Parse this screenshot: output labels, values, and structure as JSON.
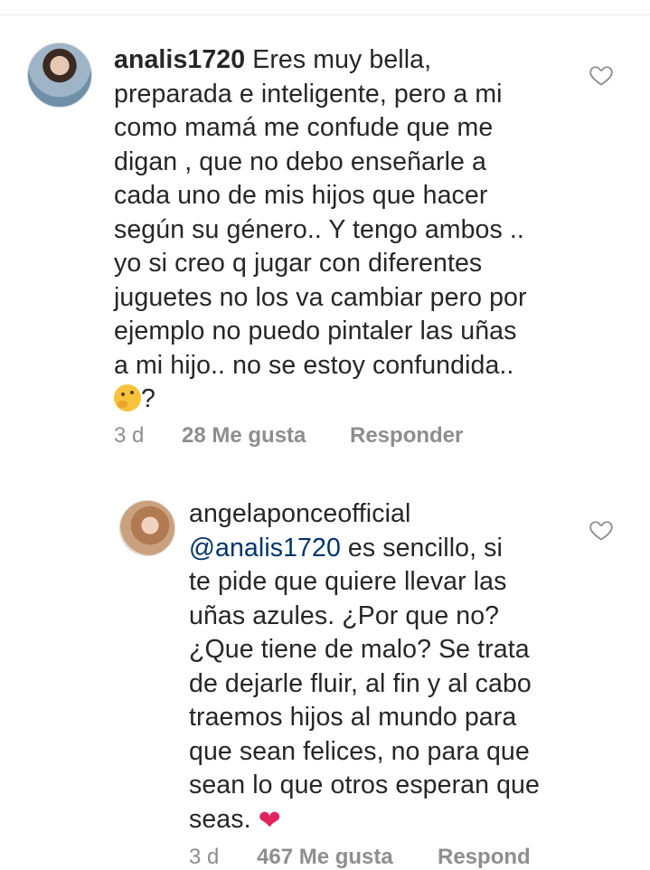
{
  "comments": [
    {
      "username": "analis1720",
      "lines": [
        " Eres muy bella,",
        "preparada e inteligente, pero a mi",
        "como mamá me confude que me",
        "digan , que no debo enseñarle a",
        "cada uno de mis hijos que hacer",
        "según su género.. Y tengo ambos ..",
        "yo si creo q jugar con diferentes",
        "juguetes no los va cambiar pero por",
        "ejemplo no puedo pintaler las uñas",
        "a mi hijo.. no se estoy confundida..",
        "?"
      ],
      "emoji": "thinking-face",
      "time": "3 d",
      "likes": "28 Me gusta",
      "reply": "Responder"
    },
    {
      "username": "angelaponceofficial",
      "mention": "@analis1720",
      "lines": [
        " es sencillo, si",
        "te pide que quiere llevar las",
        "uñas azules. ¿Por que no?",
        "¿Que tiene de malo? Se trata",
        "de dejarle fluir, al fin y al cabo",
        "traemos hijos al mundo para",
        "que sean felices, no para que",
        "sean lo que otros esperan que",
        "seas. "
      ],
      "emoji": "❤",
      "time": "3 d",
      "likes": "467 Me gusta",
      "reply": "Respond"
    }
  ]
}
